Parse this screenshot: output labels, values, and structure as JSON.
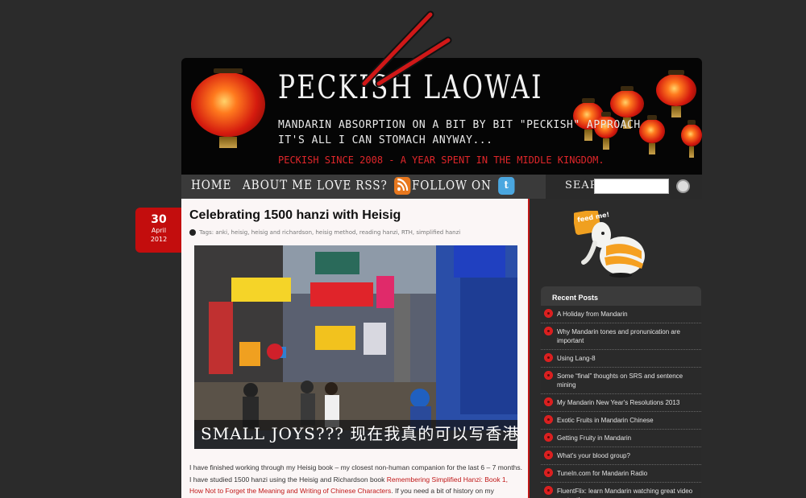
{
  "header": {
    "title": "PECKISH LAOWAI",
    "tagline_1": "MANDARIN ABSORPTION ON A BIT BY BIT \"PECKISH\" APPROACH",
    "tagline_2": "IT'S ALL I CAN STOMACH ANYWAY...",
    "tagline_3": "PECKISH SINCE 2008 - A YEAR SPENT IN THE MIDDLE KINGDOM.",
    "accent_color": "#c30d0d"
  },
  "nav": {
    "items": [
      {
        "label": "HOME",
        "icon": null
      },
      {
        "label": "ABOUT ME",
        "icon": null
      },
      {
        "label": "LOVE RSS?",
        "icon": "rss-icon"
      },
      {
        "label": "FOLLOW ON",
        "icon": "twitter-icon"
      }
    ],
    "search_label": "SEARCH"
  },
  "post": {
    "date": {
      "day": "30",
      "month": "April",
      "year": "2012"
    },
    "title": "Celebrating 1500 hanzi with Heisig",
    "tags_label": "Tags:",
    "tags": [
      "anki",
      "heisig",
      "heisig and richardson",
      "heisig method",
      "reading hanzi",
      "RTH",
      "simplified hanzi"
    ],
    "image_caption": "SMALL JOYS??? 现在我真的可以写香港",
    "body": {
      "p1_a": "I have finished working through my Heisig book – my closest non-human companion for the last 6 – 7 months. I have studied 1500 hanzi using the Heisig and Richardson book ",
      "link1": "Remembering Simplified Hanzi: Book 1, How Not to Forget the Meaning and Writing of Chinese Characters",
      "p1_b": ". If you need a bit of history on my experiences in"
    }
  },
  "sidebar": {
    "feed_label": "feed me!",
    "recent_title": "Recent Posts",
    "recent_posts": [
      "A Holiday from Mandarin",
      "Why Mandarin tones and pronunication are important",
      "Using Lang-8",
      "Some “final” thoughts on SRS and sentence mining",
      "My Mandarin New Year's Resolutions 2013",
      "Exotic Fruits in Mandarin Chinese",
      "Getting Fruity in Mandarin",
      "What's your blood group?",
      "TuneIn.com for Mandarin Radio",
      "FluentFlix: learn Mandarin watching great video content!"
    ]
  }
}
